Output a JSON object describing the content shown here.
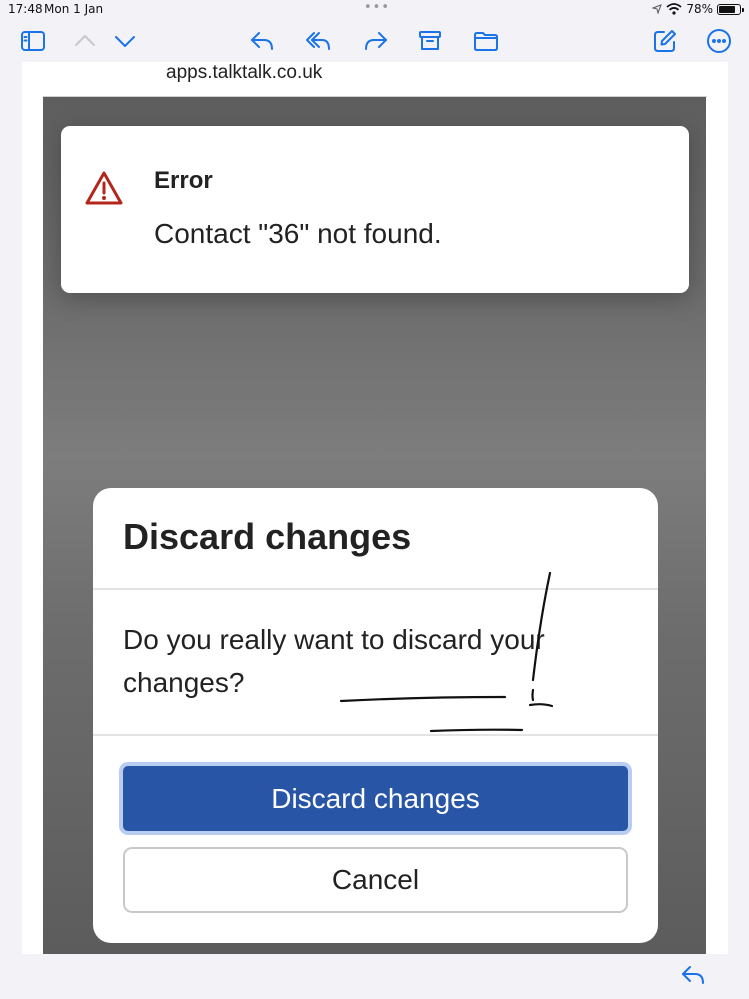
{
  "status_bar": {
    "time": "17:48",
    "date": "Mon 1 Jan",
    "battery": "78%",
    "battery_level": 0.78
  },
  "mail": {
    "url": "apps.talktalk.co.uk"
  },
  "error": {
    "title": "Error",
    "message": "Contact \"36\" not found."
  },
  "dialog": {
    "title": "Discard changes",
    "message": "Do you really want to discard your changes?",
    "primary_label": "Discard changes",
    "secondary_label": "Cancel"
  },
  "colors": {
    "accent": "#1a73e8",
    "primary_button": "#2855a5",
    "warning": "#b3261e"
  },
  "icons": {
    "toolbar": [
      "sidebar-icon",
      "chevron-up-icon",
      "chevron-down-icon",
      "reply-icon",
      "reply-all-icon",
      "forward-icon",
      "archive-icon",
      "folder-icon",
      "compose-icon",
      "more-icon"
    ],
    "bottom": "reply-icon"
  }
}
